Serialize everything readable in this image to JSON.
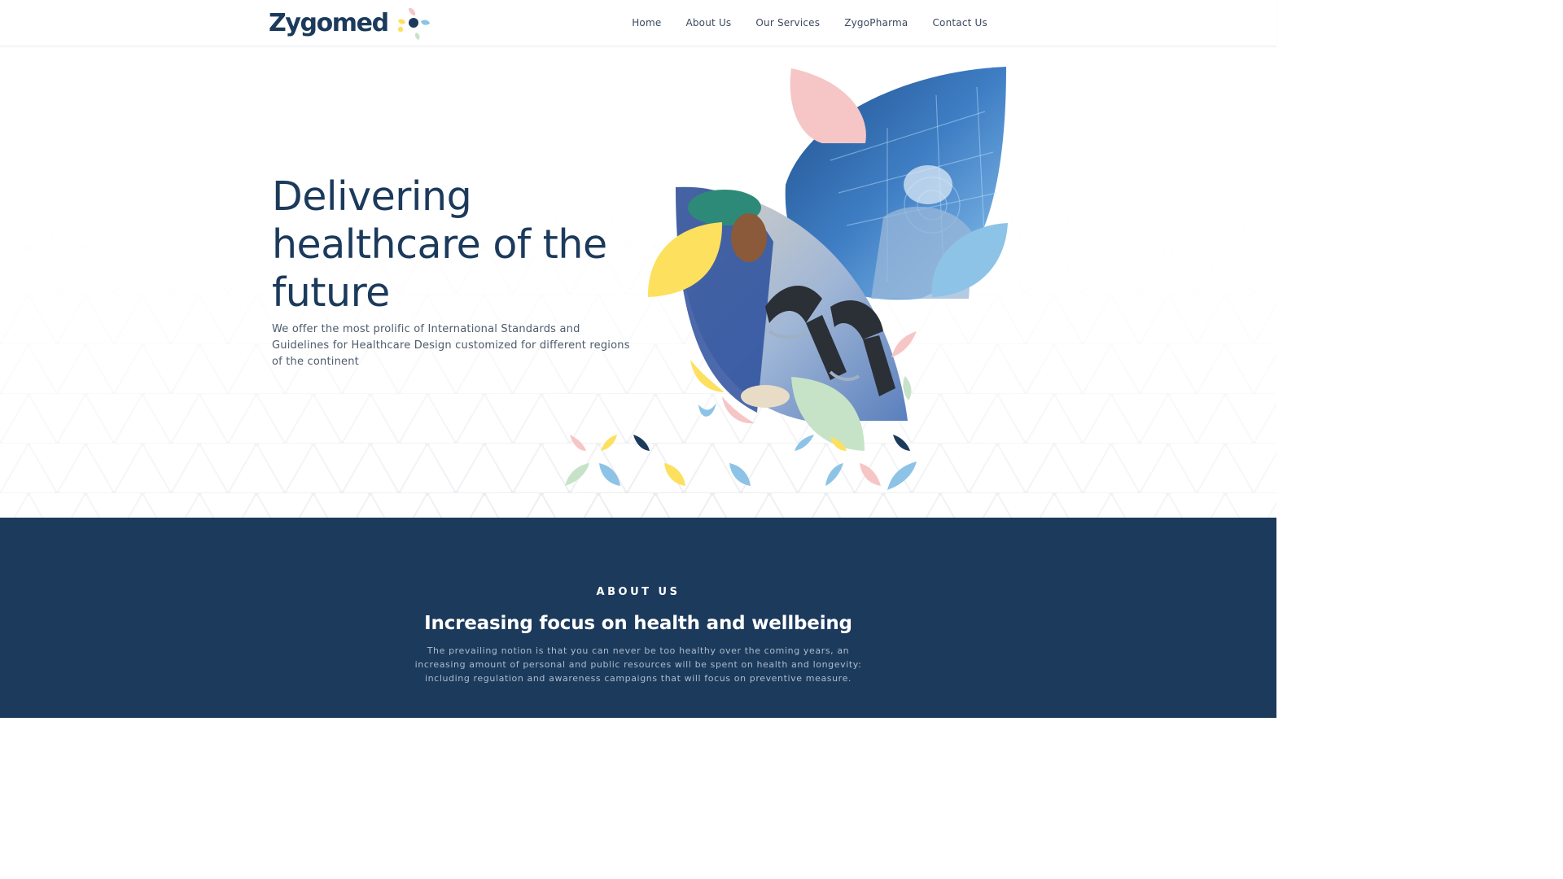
{
  "brand": {
    "name": "Zygomed",
    "colors": {
      "navy": "#1b3a5c",
      "pink": "#f6c6c6",
      "yellow": "#fde05e",
      "blue": "#8dc3e6",
      "green": "#c6e3c8"
    }
  },
  "nav": {
    "items": [
      {
        "label": "Home"
      },
      {
        "label": "About Us"
      },
      {
        "label": "Our Services"
      },
      {
        "label": "ZygoPharma"
      },
      {
        "label": "Contact Us"
      }
    ]
  },
  "hero": {
    "title": "Delivering healthcare of the future",
    "subtitle": "We offer the most prolific of International Standards and Guidelines for Healthcare Design customized for different regions of the continent"
  },
  "about": {
    "kicker": "ABOUT US",
    "title": "Increasing focus on health and wellbeing",
    "text": "The prevailing notion is that you can never be too healthy over the coming years, an increasing amount of personal and public resources will be spent on health and longevity: including regulation and awareness campaigns that will focus on preventive measure."
  }
}
